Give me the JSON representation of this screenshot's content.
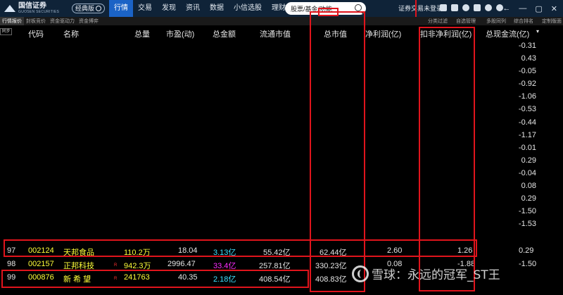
{
  "app": {
    "logo_text": "国信证券",
    "logo_sub": "GUOSEN SECURITIES",
    "edition_badge": "经典版",
    "nav": [
      "行情",
      "交易",
      "发现",
      "资讯",
      "数据",
      "小信选股",
      "理财",
      "▼"
    ],
    "search_placeholder": "股票/基金/功能",
    "login_label": "证券交易未登录",
    "window_controls": [
      "←",
      "—",
      "▢",
      "✕"
    ]
  },
  "subtabs": [
    "行情报价",
    "封板竞价",
    "资金驱动力",
    "资金博弈"
  ],
  "subtabs_right": [
    "分类过滤",
    "自选管理",
    "多股同列",
    "综合排名",
    "定制版面"
  ],
  "sync_label": "同步",
  "columns": {
    "code": "代码",
    "name": "名称",
    "volume": "总量",
    "pe": "市盈(动)",
    "amount": "总金额",
    "float_mcap": "流通市值",
    "total_mcap": "总市值",
    "net_profit": "净利润(亿)",
    "deducted_profit": "扣非净利润(亿)",
    "cash_flow": "总现金流(亿)",
    "cash_flow_marker": "▾"
  },
  "cash_flow_values": [
    "-0.31",
    "0.43",
    "-0.05",
    "-0.92",
    "-1.06",
    "-0.53",
    "-0.44",
    "-1.17",
    "-0.01",
    "0.29",
    "-0.04",
    "0.08",
    "0.29",
    "-1.50",
    "-1.53"
  ],
  "rows": [
    {
      "rank": "97",
      "code": "002124",
      "name": "天邦食品",
      "r": "",
      "volume": "110.2万",
      "pe": "18.04",
      "amount": "3.13亿",
      "float_mcap": "55.42亿",
      "total_mcap": "62.44亿",
      "net_profit": "2.60",
      "deducted_profit": "1.26"
    },
    {
      "rank": "98",
      "code": "002157",
      "name": "正邦科技",
      "r": "R",
      "volume": "942.3万",
      "pe": "2996.47",
      "amount": "33.4亿",
      "float_mcap": "257.81亿",
      "total_mcap": "330.23亿",
      "net_profit": "0.08",
      "deducted_profit": "-1.88"
    },
    {
      "rank": "99",
      "code": "000876",
      "name": "新 希 望",
      "r": "R",
      "volume": "241763",
      "pe": "40.35",
      "amount": "2.18亿",
      "float_mcap": "408.54亿",
      "total_mcap": "408.83亿",
      "net_profit": "",
      "deducted_profit": ""
    }
  ],
  "watermark": "雪球：永远的冠军_ST王",
  "colors": {
    "accent": "#1b63c6",
    "annotation": "#e0141c",
    "yellow": "#ffff3a",
    "cyan": "#3ee0ff",
    "magenta": "#ff2cff"
  }
}
